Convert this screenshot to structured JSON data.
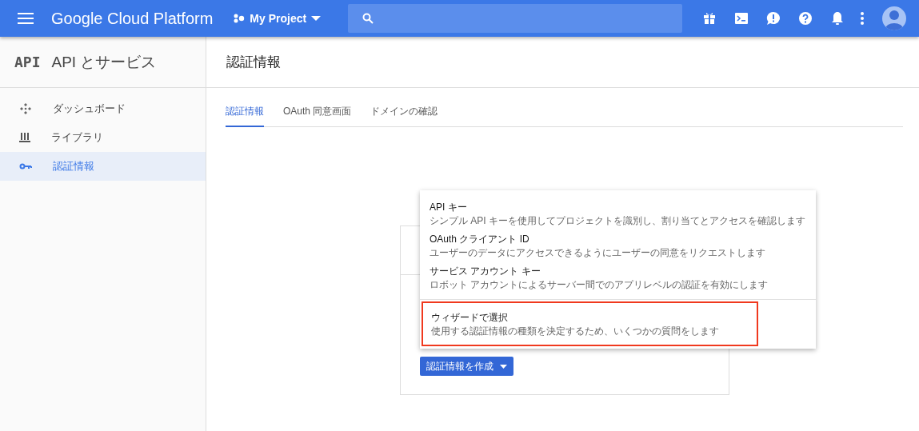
{
  "topbar": {
    "product": "Google Cloud Platform",
    "project": "My Project"
  },
  "sidebar": {
    "logo": "API",
    "title": "API とサービス",
    "items": [
      {
        "label": "ダッシュボード",
        "kind": "dashboard",
        "selected": false
      },
      {
        "label": "ライブラリ",
        "kind": "library",
        "selected": false
      },
      {
        "label": "認証情報",
        "kind": "key",
        "selected": true
      }
    ]
  },
  "page": {
    "title": "認証情報",
    "tabs": [
      {
        "label": "認証情報",
        "selected": true
      },
      {
        "label": "OAuth 同意画面",
        "selected": false
      },
      {
        "label": "ドメインの確認",
        "selected": false
      }
    ]
  },
  "create_button": "認証情報を作成",
  "menu": [
    {
      "title": "API キー",
      "description": "シンプル API キーを使用してプロジェクトを識別し、割り当てとアクセスを確認します",
      "divider_before": false,
      "highlighted": false
    },
    {
      "title": "OAuth クライアント ID",
      "description": "ユーザーのデータにアクセスできるようにユーザーの同意をリクエストします",
      "divider_before": false,
      "highlighted": false
    },
    {
      "title": "サービス アカウント キー",
      "description": "ロボット アカウントによるサーバー間でのアプリレベルの認証を有効にします",
      "divider_before": false,
      "highlighted": false
    },
    {
      "title": "ウィザードで選択",
      "description": "使用する認証情報の種類を決定するため、いくつかの質問をします",
      "divider_before": true,
      "highlighted": true
    }
  ]
}
